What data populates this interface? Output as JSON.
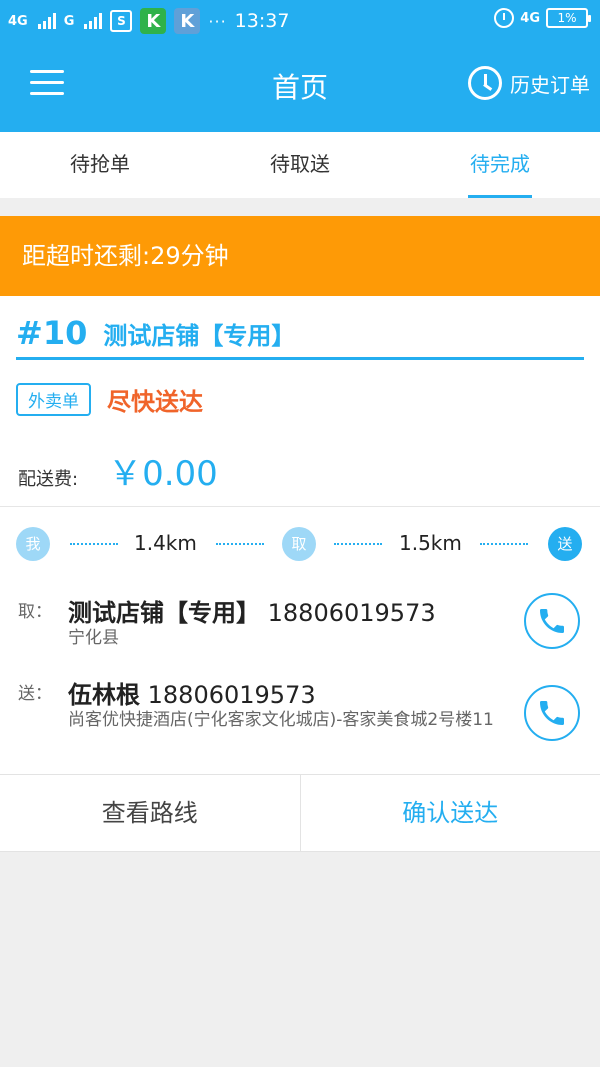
{
  "status_bar": {
    "signal1": "4G",
    "signal2": "G",
    "app_icon_s": "S",
    "app_icon_k1": "K",
    "app_icon_k2": "K",
    "more": "···",
    "time": "13:37",
    "network": "4G",
    "battery": "1%"
  },
  "appbar": {
    "title": "首页",
    "history_label": "历史订单"
  },
  "tabs": [
    {
      "label": "待抢单",
      "active": false
    },
    {
      "label": "待取送",
      "active": false
    },
    {
      "label": "待完成",
      "active": true
    }
  ],
  "order": {
    "timeout_text": "距超时还剩:29分钟",
    "number": "#10",
    "store": "测试店铺【专用】",
    "tag": "外卖单",
    "priority": "尽快送达",
    "fee_label": "配送费:",
    "fee_value": "￥0.00"
  },
  "route": {
    "node_me": "我",
    "dist_1": "1.4km",
    "node_pickup": "取",
    "dist_2": "1.5km",
    "node_deliver": "送"
  },
  "pickup": {
    "label": "取：",
    "name": "测试店铺【专用】",
    "phone": "18806019573",
    "address": "宁化县"
  },
  "delivery": {
    "label": "送：",
    "name": "伍林根",
    "phone": "18806019573",
    "address": "尚客优快捷酒店(宁化客家文化城店)-客家美食城2号楼11"
  },
  "actions": {
    "view_route": "查看路线",
    "confirm": "确认送达"
  },
  "colors": {
    "primary": "#24aef0",
    "warning": "#fe9a06",
    "urgent": "#f0642a"
  }
}
